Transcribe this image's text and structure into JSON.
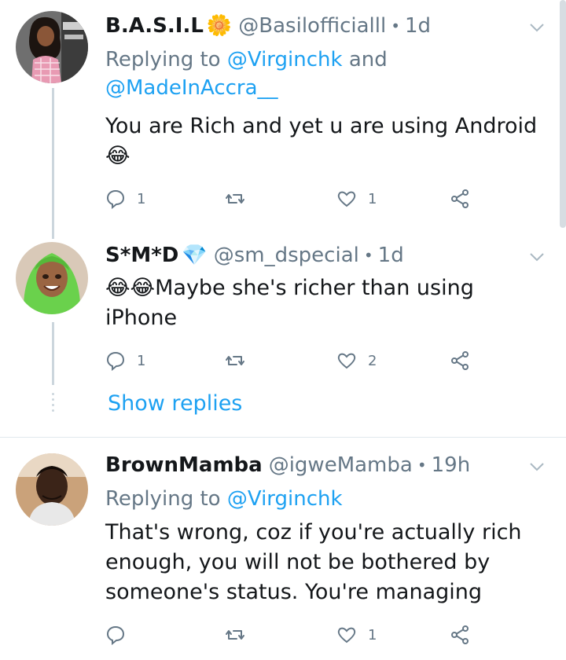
{
  "tweets": [
    {
      "name": "B.A.S.I.L",
      "name_emoji": "🌼",
      "handle": "@Basilofficialll",
      "time": "1d",
      "reply_prefix": "Replying to ",
      "reply_users": [
        "@Virginchk",
        "@MadeInAccra__"
      ],
      "reply_and": " and",
      "text_line1": "You are Rich and yet u are using Android",
      "text_line2": "😂",
      "reply_count": "1",
      "retweet_count": "",
      "like_count": "1"
    },
    {
      "name": "S*M*D",
      "name_emoji": "💎",
      "handle": "@sm_dspecial",
      "time": "1d",
      "text_line1": "😂😂Maybe she's richer than using",
      "text_line2": "iPhone",
      "reply_count": "1",
      "retweet_count": "",
      "like_count": "2"
    },
    {
      "name": "BrownMamba",
      "handle": "@igweMamba",
      "time": "19h",
      "reply_prefix": "Replying to ",
      "reply_users": [
        "@Virginchk"
      ],
      "text_line1": "That's wrong, coz if you're actually rich",
      "text_line2": "enough, you will not be bothered by",
      "text_line3": "someone's status. You're managing",
      "reply_count": "",
      "retweet_count": "",
      "like_count": "1"
    }
  ],
  "show_replies_label": "Show replies",
  "colors": {
    "link": "#1da1f2",
    "muted": "#657786",
    "text": "#14171a",
    "separator": "#e1e8ed",
    "thread": "#ccd6dd"
  }
}
